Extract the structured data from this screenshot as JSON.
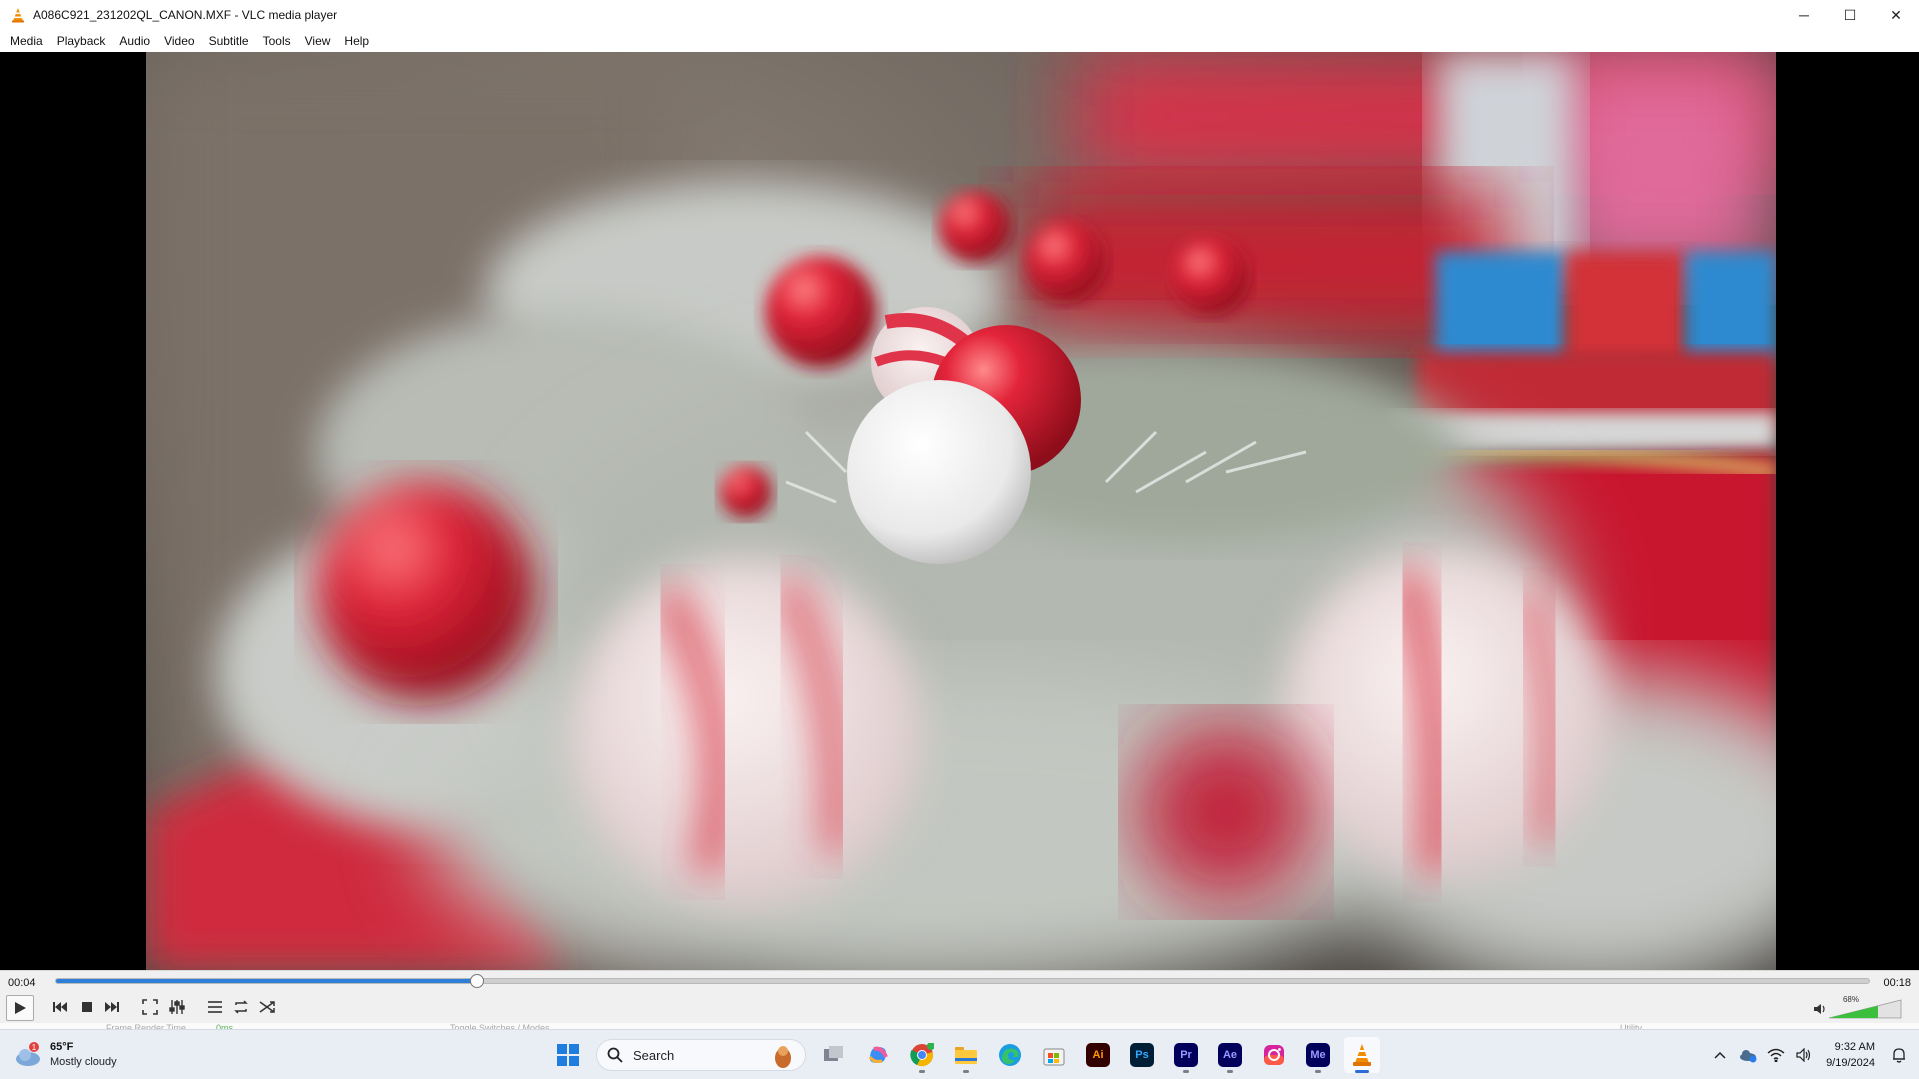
{
  "window": {
    "title": "A086C921_231202QL_CANON.MXF - VLC media player",
    "controls": {
      "minimize": "─",
      "maximize": "☐",
      "close": "✕"
    }
  },
  "menu": [
    "Media",
    "Playback",
    "Audio",
    "Video",
    "Subtitle",
    "Tools",
    "View",
    "Help"
  ],
  "player": {
    "time_elapsed": "00:04",
    "time_total": "00:18",
    "progress": 0.232,
    "volume_label": "68%",
    "volume": 0.68,
    "buttons": [
      "play-icon",
      "previous-icon",
      "stop-icon",
      "next-icon",
      "fullscreen-icon",
      "extended-settings-icon",
      "playlist-icon",
      "loop-icon",
      "shuffle-icon"
    ]
  },
  "background_strip": {
    "left": "Frame Render Time",
    "left_value": "0ms",
    "middle": "Toggle Switches / Modes",
    "right": "Utility"
  },
  "taskbar": {
    "weather": {
      "temp": "65°F",
      "desc": "Mostly cloudy",
      "badge": "1"
    },
    "search_label": "Search",
    "apps": [
      {
        "name": "task-view",
        "label": ""
      },
      {
        "name": "copilot",
        "label": ""
      },
      {
        "name": "chrome",
        "label": ""
      },
      {
        "name": "file-explorer",
        "label": ""
      },
      {
        "name": "edge",
        "label": ""
      },
      {
        "name": "microsoft-store",
        "label": ""
      },
      {
        "name": "illustrator",
        "label": "Ai",
        "bg": "#330000",
        "fg": "#ff9a00"
      },
      {
        "name": "photoshop",
        "label": "Ps",
        "bg": "#001e36",
        "fg": "#31a8ff"
      },
      {
        "name": "premiere",
        "label": "Pr",
        "bg": "#00005b",
        "fg": "#9999ff"
      },
      {
        "name": "after-effects",
        "label": "Ae",
        "bg": "#00005b",
        "fg": "#9999ff"
      },
      {
        "name": "instagram",
        "label": ""
      },
      {
        "name": "media-encoder",
        "label": "Me",
        "bg": "#00005b",
        "fg": "#9999ff"
      },
      {
        "name": "vlc",
        "label": ""
      }
    ],
    "clock": {
      "time": "9:32 AM",
      "date": "9/19/2024"
    }
  }
}
